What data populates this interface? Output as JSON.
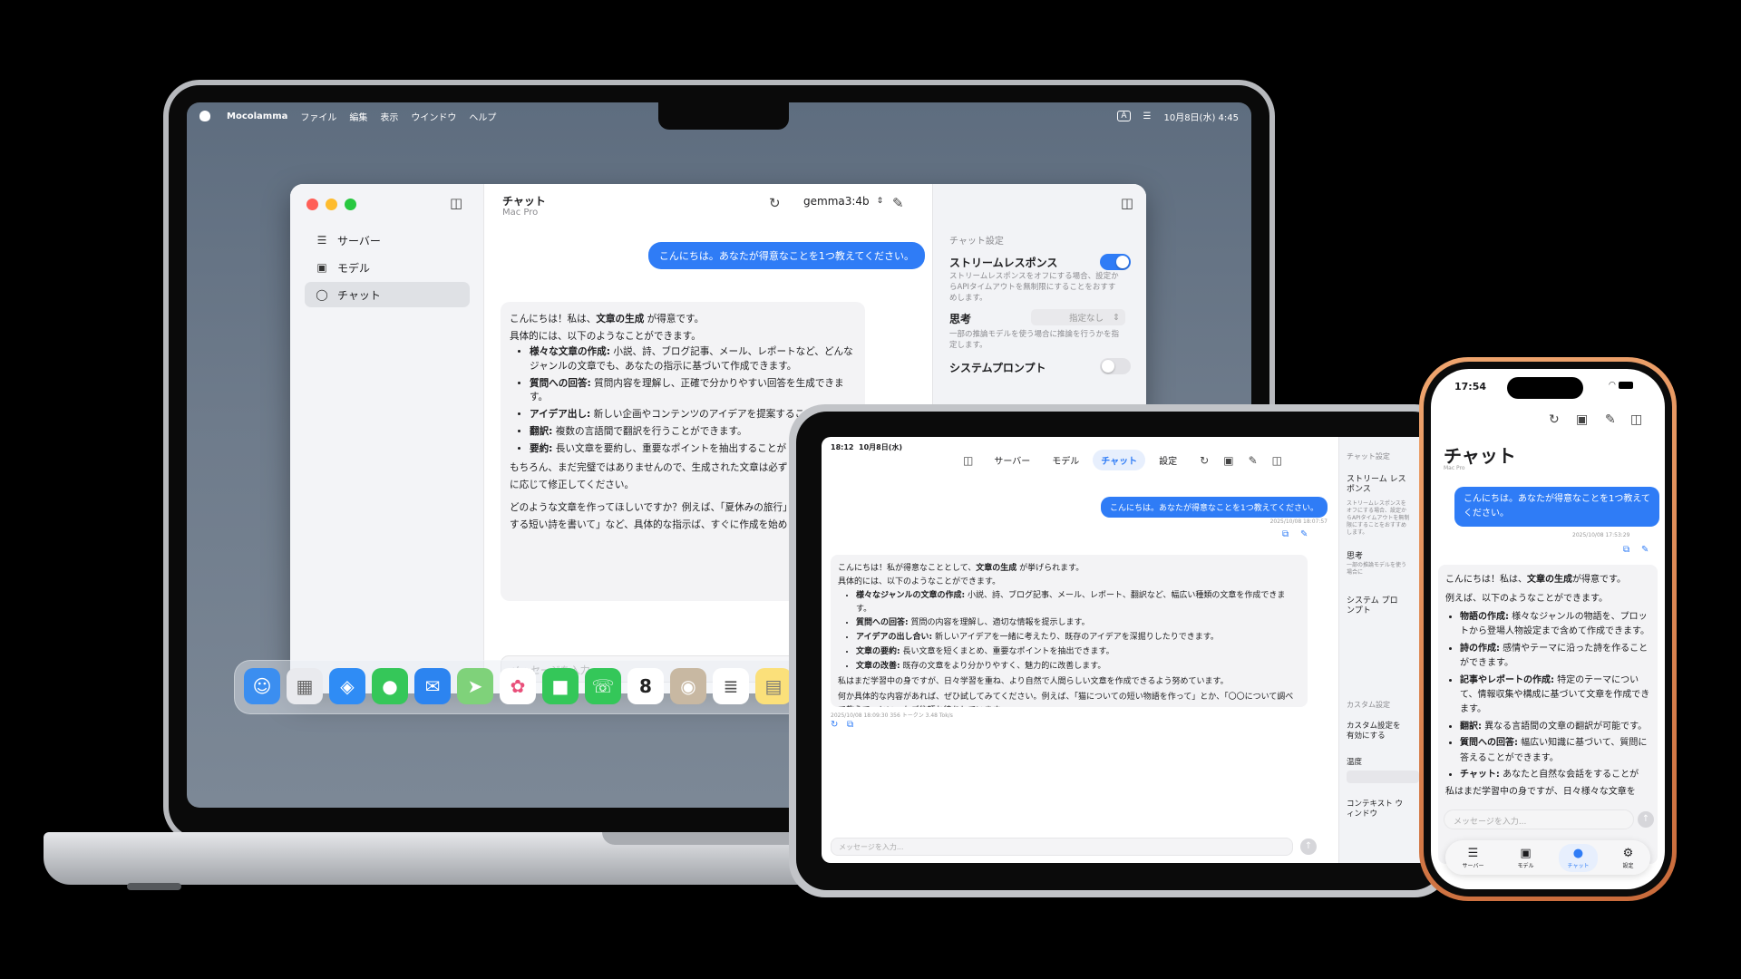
{
  "colors": {
    "accent": "#2f7cf6",
    "phone_frame": "#e08a55"
  },
  "mac": {
    "menubar": {
      "app": "Mocolamma",
      "menus": [
        "ファイル",
        "編集",
        "表示",
        "ウインドウ",
        "ヘルプ"
      ],
      "input_indicator": "A",
      "datetime": "10月8日(水) 4:45"
    },
    "window": {
      "sidebar": [
        {
          "label": "サーバー",
          "icon": "server-icon"
        },
        {
          "label": "モデル",
          "icon": "model-icon"
        },
        {
          "label": "チャット",
          "icon": "chat-icon"
        }
      ],
      "title": "チャット",
      "subtitle": "Mac Pro",
      "model": "gemma3:4b",
      "user_message": "こんにちは。あなたが得意なことを1つ教えてください。",
      "answer": {
        "intro_pre": "こんにちは！私は、",
        "intro_bold": "文章の生成",
        "intro_post": " が得意です。",
        "lead": "具体的には、以下のようなことができます。",
        "bullets": [
          {
            "b": "様々な文章の作成:",
            "t": " 小説、詩、ブログ記事、メール、レポートなど、どんなジャンルの文章でも、あなたの指示に基づいて作成できます。"
          },
          {
            "b": "質問への回答:",
            "t": " 質問内容を理解し、正確で分かりやすい回答を生成できます。"
          },
          {
            "b": "アイデア出し:",
            "t": " 新しい企画やコンテンツのアイデアを提案すること能です。"
          },
          {
            "b": "翻訳:",
            "t": " 複数の言語間で翻訳を行うことができます。"
          },
          {
            "b": "要約:",
            "t": " 長い文章を要約し、重要なポイントを抽出することが"
          }
        ],
        "p1": "もちろん、まだ完璧ではありませんので、生成された文章は必ずご確認し、必要に応じて修正してください。",
        "p2": "どのような文章を作ってほしいですか？例えば、「夏休みの旅行」とか、「猫に関する短い詩を書いて」など、具体的な指示ば、すぐに作成を始められます。"
      },
      "input_placeholder": "メッセージを入力...",
      "settings": {
        "section": "チャット設定",
        "stream_title": "ストリームレスポンス",
        "stream_desc": "ストリームレスポンスをオフにする場合、設定からAPIタイムアウトを無制限にすることをおすすめします。",
        "stream_on": true,
        "thinking_title": "思考",
        "thinking_value": "指定なし",
        "thinking_desc": "一部の推論モデルを使う場合に推論を行うかを指定します。",
        "system_prompt_title": "システムプロンプト",
        "system_prompt_on": false
      }
    },
    "dock_icons": [
      "finder-icon",
      "launchpad-icon",
      "safari-icon",
      "messages-icon",
      "mail-icon",
      "maps-icon",
      "photos-icon",
      "facetime-icon",
      "phone-icon",
      "calendar-icon",
      "contacts-icon",
      "reminders-icon",
      "notes-icon"
    ],
    "dock_calendar_day": "8"
  },
  "ipad": {
    "status_time": "18:12",
    "status_date": "10月8日(水)",
    "tabs": [
      "サーバー",
      "モデル",
      "チャット",
      "設定"
    ],
    "selected_tab": "チャット",
    "user_message": "こんにちは。あなたが得意なことを1つ教えてください。",
    "user_timestamp": "2025/10/08 18:07:57",
    "answer": {
      "intro_pre": "こんにちは！私が得意なこととして、",
      "intro_bold": "文章の生成",
      "intro_post": " が挙げられます。",
      "lead": "具体的には、以下のようなことができます。",
      "bullets": [
        {
          "b": "様々なジャンルの文章の作成:",
          "t": " 小説、詩、ブログ記事、メール、レポート、翻訳など、幅広い種類の文章を作成できます。"
        },
        {
          "b": "質問への回答:",
          "t": " 質問の内容を理解し、適切な情報を提示します。"
        },
        {
          "b": "アイデアの出し合い:",
          "t": " 新しいアイデアを一緒に考えたり、既存のアイデアを深掘りしたりできます。"
        },
        {
          "b": "文章の要約:",
          "t": " 長い文章を短くまとめ、重要なポイントを抽出できます。"
        },
        {
          "b": "文章の改善:",
          "t": " 既存の文章をより分かりやすく、魅力的に改善します。"
        }
      ],
      "p1": "私はまだ学習中の身ですが、日々学習を重ね、より自然で人間らしい文章を作成できるよう努めています。",
      "p2": "何か具体的な内容があれば、ぜひ試してみてください。例えば、「猫についての短い物語を作って」とか、「〇〇について調べて教えて」といったご依頼お待ちしています。"
    },
    "answer_meta": "2025/10/08 18:09:30   356 トークン   3.48 Tok/s",
    "input_placeholder": "メッセージを入力...",
    "settings": {
      "section": "チャット設定",
      "stream": "ストリーム レスポンス",
      "stream_desc": "ストリームレスポンスをオフにする場合、設定からAPIタイムアウトを無制限にすることをおすすめします。",
      "thinking": "思考",
      "thinking_desc": "一部の推論モデルを使う場合に",
      "system_prompt": "システム プロンプト",
      "custom_section": "カスタム設定",
      "custom_enable": "カスタム設定を 有効にする",
      "temperature": "温度",
      "context_window": "コンテキスト ウィンドウ"
    }
  },
  "iphone": {
    "status_time": "17:54",
    "title": "チャット",
    "subtitle": "Mac Pro",
    "user_message": "こんにちは。あなたが得意なことを1つ教えてください。",
    "user_timestamp": "2025/10/08 17:53:29",
    "answer": {
      "intro_pre": "こんにちは！私は、",
      "intro_bold": "文章の生成",
      "intro_post": "が得意です。",
      "lead": "例えば、以下のようなことができます。",
      "bullets": [
        {
          "b": "物語の作成:",
          "t": " 様々なジャンルの物語を、プロットから登場人物設定まで含めて作成できます。"
        },
        {
          "b": "詩の作成:",
          "t": " 感情やテーマに沿った詩を作ることができます。"
        },
        {
          "b": "記事やレポートの作成:",
          "t": " 特定のテーマについて、情報収集や構成に基づいて文章を作成できます。"
        },
        {
          "b": "翻訳:",
          "t": " 異なる言語間の文章の翻訳が可能です。"
        },
        {
          "b": "質問への回答:",
          "t": " 幅広い知識に基づいて、質問に答えることができます。"
        },
        {
          "b": "チャット:",
          "t": " あなたと自然な会話をすることが"
        }
      ],
      "p1": "私はまだ学習中の身ですが、日々様々な文章を"
    },
    "input_placeholder": "メッセージを入力...",
    "tabs": [
      "サーバー",
      "モデル",
      "チャット",
      "設定"
    ],
    "selected_tab": "チャット"
  }
}
